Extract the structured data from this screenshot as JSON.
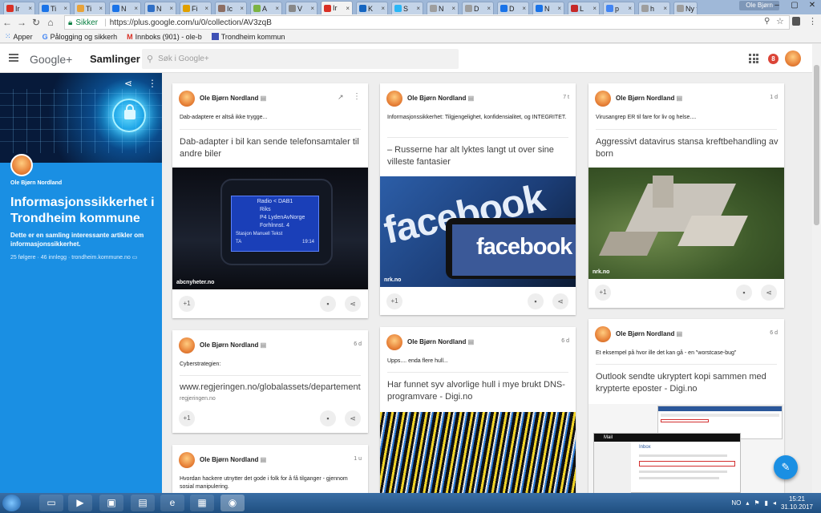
{
  "browser": {
    "tabs": [
      {
        "label": "Ir",
        "color": "#d93025"
      },
      {
        "label": "Ti",
        "color": "#1a73e8"
      },
      {
        "label": "Ti",
        "color": "#e8a33a"
      },
      {
        "label": "N",
        "color": "#1a73e8"
      },
      {
        "label": "N",
        "color": "#2f6fc6"
      },
      {
        "label": "Fi",
        "color": "#e0a000"
      },
      {
        "label": "Ic",
        "color": "#8d6e63"
      },
      {
        "label": "A",
        "color": "#7cb342"
      },
      {
        "label": "V",
        "color": "#888888"
      },
      {
        "label": "Ir",
        "color": "#d93025",
        "active": true
      },
      {
        "label": "K",
        "color": "#1565c0"
      },
      {
        "label": "S",
        "color": "#29b6f6"
      },
      {
        "label": "N",
        "color": "#9e9e9e"
      },
      {
        "label": "D",
        "color": "#9e9e9e"
      },
      {
        "label": "D",
        "color": "#1a73e8"
      },
      {
        "label": "N",
        "color": "#1a73e8"
      },
      {
        "label": "L",
        "color": "#c62828"
      },
      {
        "label": "p",
        "color": "#4285f4"
      },
      {
        "label": "h",
        "color": "#9e9e9e"
      },
      {
        "label": "Ny fa",
        "color": "#9e9e9e"
      }
    ],
    "user": "Ole Bjørn",
    "window_buttons": [
      "–",
      "▢",
      "✕"
    ],
    "secure_label": "Sikker",
    "url": "https://plus.google.com/u/0/collection/AV3zqB",
    "bookmarks": [
      {
        "label": "Apper",
        "icon": "apps-grid-icon"
      },
      {
        "label": "Pålogging og sikkerh",
        "icon": "google-g-icon"
      },
      {
        "label": "Innboks (901) - ole-b",
        "icon": "gmail-icon"
      },
      {
        "label": "Trondheim kommun",
        "icon": "calendar-icon"
      }
    ]
  },
  "header": {
    "logo": "Google+",
    "section": "Samlinger",
    "search_placeholder": "Søk i Google+",
    "notification_count": "8"
  },
  "collection": {
    "owner": "Ole Bjørn Nordland",
    "title": "Informasjonssikkerhet i Trondheim kommune",
    "description": "Dette er en samling interessante artikler om informasjonssikkerhet.",
    "meta": "25 følgere · 46 innlegg · trondheim.kommune.no"
  },
  "cards": [
    {
      "author": "Ole Bjørn Nordland",
      "time": "",
      "note": "Dab-adaptere er altså ikke trygge...",
      "link": "Dab-adapter i bil kan sende telefonsamtaler til andre biler",
      "source": "abcnyheter.no",
      "plus": "+1",
      "image": "car-radio",
      "radio_lines": [
        "Radio < DAB1",
        "Riks",
        "P4 LydenAvNorge",
        "Forhlnnst. 4",
        "Stasjon  Manuell  Tekst",
        "TA",
        "19:14"
      ]
    },
    {
      "author": "Ole Bjørn Nordland",
      "time": "7 t",
      "note": "Informasjonssikkerhet: Tilgjengelighet, konfidensialitet, og INTEGRITET.",
      "link": "– Russerne har alt lyktes langt ut over sine villeste fantasier",
      "source": "nrk.no",
      "plus": "+1",
      "image": "facebook",
      "image_words": [
        "facebook",
        "facebook"
      ]
    },
    {
      "author": "Ole Bjørn Nordland",
      "time": "1 d",
      "note": "Virusangrep ER til fare for liv og helse....",
      "link": "Aggressivt datavirus stansa kreftbehandling av born",
      "source": "nrk.no",
      "plus": "+1",
      "image": "hospital"
    },
    {
      "author": "Ole Bjørn Nordland",
      "time": "6 d",
      "note": "Cyberstrategien:",
      "link": "www.regjeringen.no/globalassets/departement",
      "source": "regjeringen.no",
      "plus": "+1"
    },
    {
      "author": "Ole Bjørn Nordland",
      "time": "6 d",
      "note": "Upps.... enda flere hull...",
      "link": "Har funnet syv alvorlige hull i mye brukt DNS-programvare - Digi.no",
      "image": "cables"
    },
    {
      "author": "Ole Bjørn Nordland",
      "time": "6 d",
      "note": "Et eksempel på hvor ille det kan gå - en \"worstcase-bug\"",
      "link": "Outlook sendte ukryptert kopi sammen med krypterte eposter - Digi.no",
      "image": "outlook",
      "mail_title": "Mail",
      "mail_folder": "Inbox"
    },
    {
      "author": "Ole Bjørn Nordland",
      "time": "1 u",
      "note": "Hvordan hackere utnytter det gode i folk for å få tilganger - gjennom sosial manipulering."
    }
  ],
  "taskbar": {
    "language": "NO",
    "time": "15:21",
    "date": "31.10.2017"
  }
}
